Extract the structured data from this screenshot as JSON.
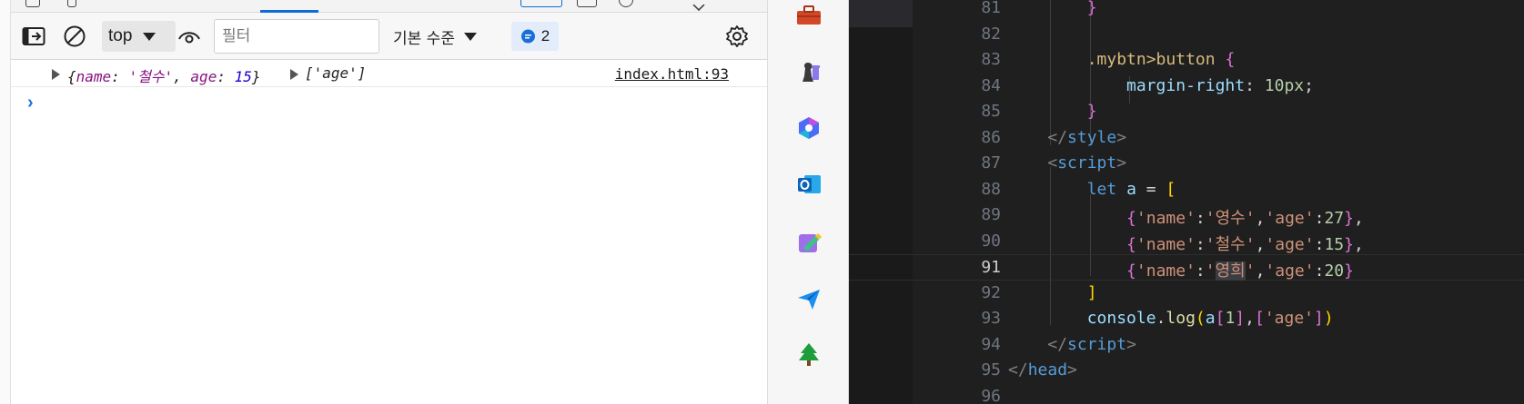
{
  "devtools": {
    "toolbar": {
      "context_select": "top",
      "filter_placeholder": "필터",
      "log_level": "기본 수준",
      "issues_count": "2"
    },
    "console": {
      "entries": [
        {
          "object_preview": {
            "open": "{",
            "key1": "name",
            "sep1": ": ",
            "val1": "'철수'",
            "comma": ", ",
            "key2": "age",
            "sep2": ": ",
            "val2": "15",
            "close": "}"
          },
          "array_preview": "['age']",
          "source": "index.html:93"
        }
      ],
      "prompt": "›"
    }
  },
  "sidebar": {
    "icons": [
      "toolbox-icon",
      "chess-icon",
      "copilot-icon",
      "outlook-icon",
      "designer-icon",
      "send-icon",
      "tree-icon"
    ]
  },
  "editor": {
    "current_line": 91,
    "lines": [
      {
        "n": "81"
      },
      {
        "n": "82"
      },
      {
        "n": "83"
      },
      {
        "n": "84"
      },
      {
        "n": "85"
      },
      {
        "n": "86"
      },
      {
        "n": "87"
      },
      {
        "n": "88"
      },
      {
        "n": "89"
      },
      {
        "n": "90"
      },
      {
        "n": "91"
      },
      {
        "n": "92"
      },
      {
        "n": "93"
      },
      {
        "n": "94"
      },
      {
        "n": "95"
      },
      {
        "n": "96"
      }
    ],
    "code": {
      "l83_selector": ".mybtn>button",
      "l84_prop": "margin-right",
      "l84_value": "10px",
      "l86_tag": "style",
      "l87_tag": "script",
      "l88_kw": "let",
      "l88_var": "a",
      "l89_key": "'name'",
      "l89_name": "'영수'",
      "l89_agekey": "'age'",
      "l89_age": "27",
      "l90_key": "'name'",
      "l90_name": "'철수'",
      "l90_agekey": "'age'",
      "l90_age": "15",
      "l91_key": "'name'",
      "l91_name_open": "'",
      "l91_name_sel": "영희",
      "l91_name_close": "'",
      "l91_agekey": "'age'",
      "l91_age": "20",
      "l93_obj": "console",
      "l93_fn": "log",
      "l93_var": "a",
      "l93_idx": "1",
      "l93_str": "'age'",
      "l94_tag": "script",
      "l95_tag": "head"
    }
  }
}
